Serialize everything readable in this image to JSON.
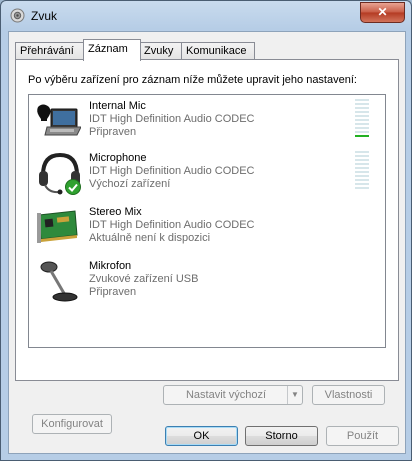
{
  "window": {
    "title": "Zvuk",
    "close_label": "✕"
  },
  "tabs": [
    {
      "label": "Přehrávání",
      "active": false
    },
    {
      "label": "Záznam",
      "active": true
    },
    {
      "label": "Zvuky",
      "active": false
    },
    {
      "label": "Komunikace",
      "active": false
    }
  ],
  "panel": {
    "intro": "Po výběru zařízení pro záznam níže můžete upravit jeho nastavení:"
  },
  "devices": [
    {
      "name": "Internal Mic",
      "driver": "IDT High Definition Audio CODEC",
      "status": "Připraven",
      "icon": "laptop-mic-icon",
      "meter_level_bars": 1,
      "meter_total_bars": 10
    },
    {
      "name": "Microphone",
      "driver": "IDT High Definition Audio CODEC",
      "status": "Výchozí zařízení",
      "icon": "headset-icon",
      "default_badge": "check-icon",
      "meter_level_bars": 0,
      "meter_total_bars": 10
    },
    {
      "name": "Stereo Mix",
      "driver": "IDT High Definition Audio CODEC",
      "status": "Aktuálně není k dispozici",
      "icon": "sound-card-icon"
    },
    {
      "name": "Mikrofon",
      "driver": "Zvukové zařízení USB",
      "status": "Připraven",
      "icon": "desk-mic-icon"
    }
  ],
  "panel_buttons": {
    "configure": "Konfigurovat",
    "set_default": "Nastavit výchozí",
    "properties": "Vlastnosti"
  },
  "dialog_buttons": {
    "ok": "OK",
    "cancel": "Storno",
    "apply": "Použít"
  },
  "colors": {
    "meter_on": "#22b122",
    "meter_off": "#d7e6ea",
    "close_button": "#c75a44"
  }
}
